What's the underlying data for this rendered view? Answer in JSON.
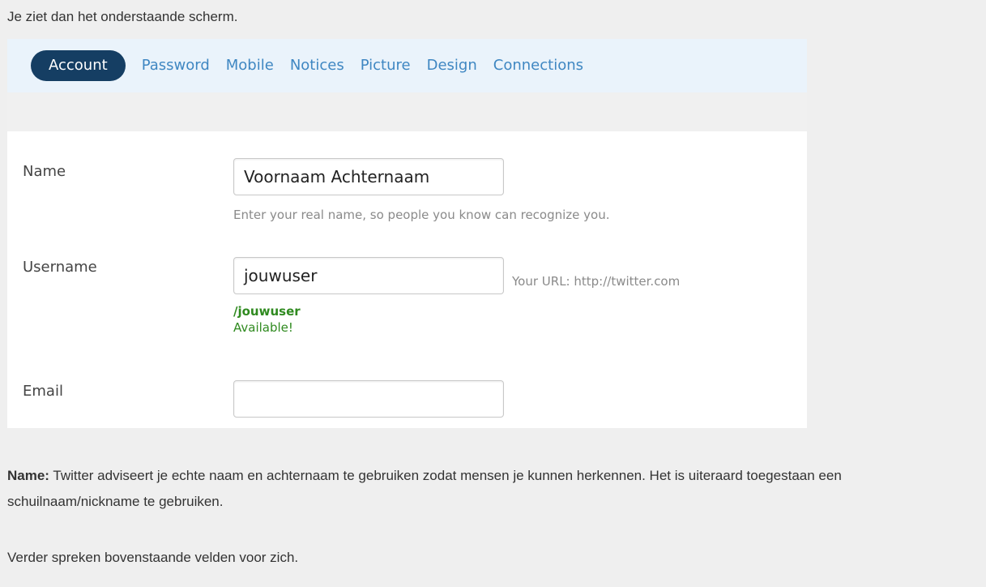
{
  "intro_text": "Je ziet dan het onderstaande scherm.",
  "tabs": [
    {
      "label": "Account",
      "active": true
    },
    {
      "label": "Password",
      "active": false
    },
    {
      "label": "Mobile",
      "active": false
    },
    {
      "label": "Notices",
      "active": false
    },
    {
      "label": "Picture",
      "active": false
    },
    {
      "label": "Design",
      "active": false
    },
    {
      "label": "Connections",
      "active": false
    }
  ],
  "form": {
    "name": {
      "label": "Name",
      "value": "Voornaam  Achternaam",
      "hint": "Enter your real name, so people you know can recognize you."
    },
    "username": {
      "label": "Username",
      "value": "jouwuser",
      "url_note": "Your URL: http://twitter.com",
      "url_suffix": "/jouwuser",
      "status": "Available!"
    },
    "email": {
      "label": "Email",
      "value": ""
    }
  },
  "explanation": {
    "name_heading": "Name:",
    "name_text": " Twitter adviseert je echte naam en achternaam te gebruiken zodat mensen je kunnen herkennen. Het is uiteraard toegestaan een schuilnaam/nickname te gebruiken.",
    "closing": "Verder spreken bovenstaande velden voor zich."
  },
  "colors": {
    "active_tab_bg": "#153e63",
    "tab_link": "#3f87c2",
    "tab_bar_bg": "#eaf3fb",
    "available_green": "#2f8a1f"
  }
}
